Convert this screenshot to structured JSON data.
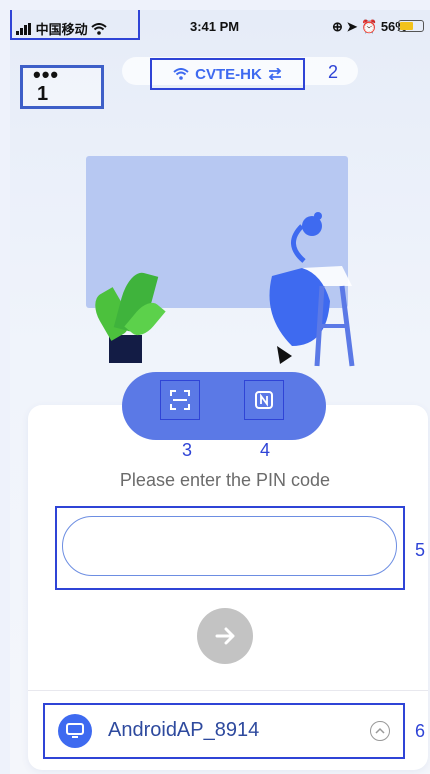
{
  "status_bar": {
    "carrier": "中国移动",
    "time": "3:41 PM",
    "battery": "56%",
    "battery_level": 0.56
  },
  "top": {
    "more_dots": "•••",
    "wifi_name": "CVTE-HK"
  },
  "pin": {
    "prompt": "Please enter the PIN code",
    "value": ""
  },
  "device": {
    "name": "AndroidAP_8914"
  },
  "markers": [
    "1",
    "2",
    "3",
    "4",
    "5",
    "6"
  ],
  "icons": {
    "signal": "signal-icon",
    "wifi": "wifi-icon",
    "switch": "switch-arrows-icon",
    "scan": "scan-icon",
    "nfc": "nfc-icon",
    "go": "arrow-right-icon",
    "device": "monitor-icon",
    "chevron": "chevron-up-icon"
  },
  "colors": {
    "accent": "#3e6af0",
    "bar": "#5b79e6",
    "annotation": "#2f44d6"
  }
}
